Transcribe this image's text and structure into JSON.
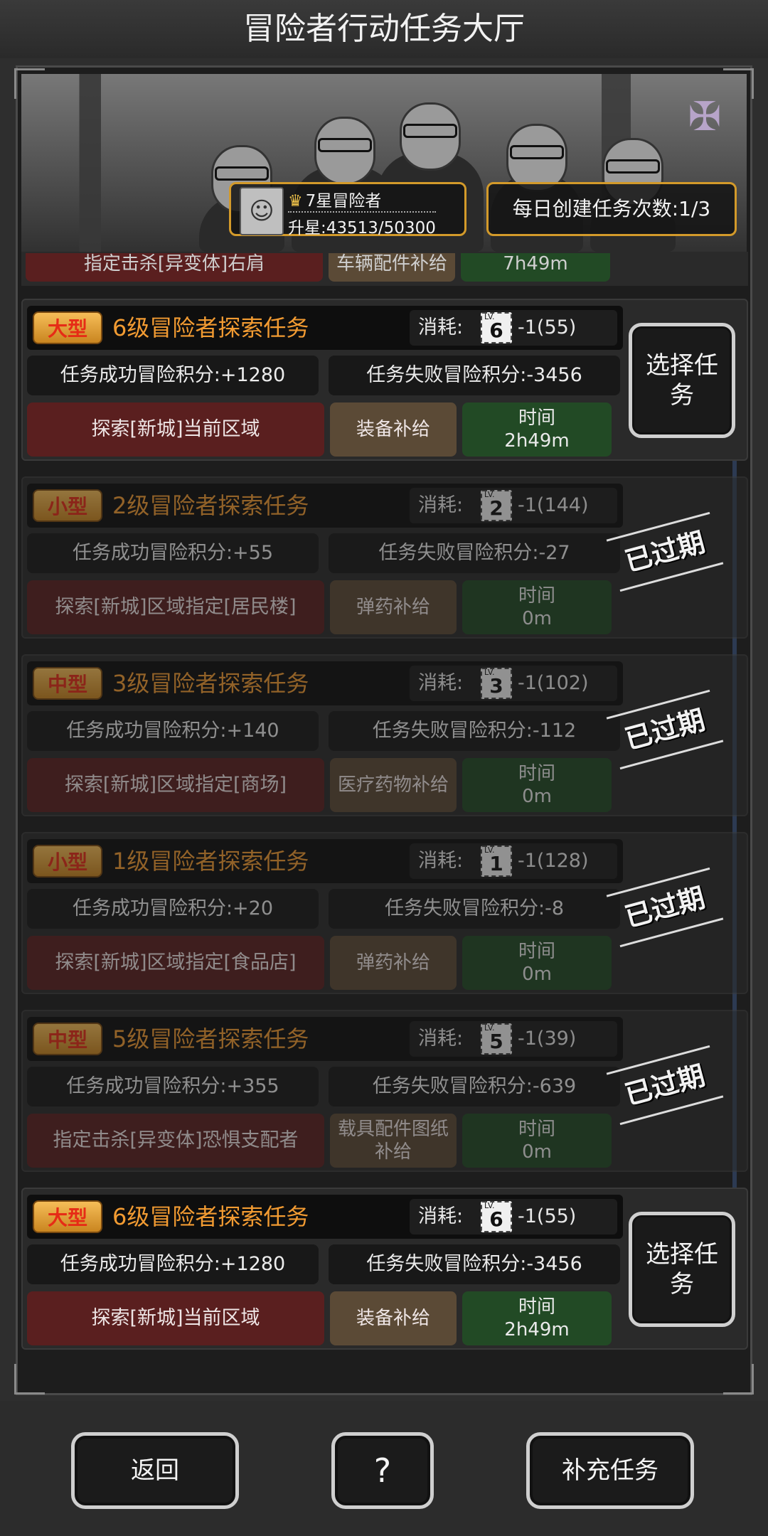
{
  "title": "冒险者行动任务大厅",
  "header": {
    "rank_name": "7星冒险者",
    "rank_progress": "升星:43513/50300",
    "daily_quota": "每日创建任务次数:1/3"
  },
  "partial_card": {
    "area": "指定击杀[异变体]右肩",
    "supply": "车辆配件补给",
    "time": "7h49m"
  },
  "missions": [
    {
      "tag": "大型",
      "title": "6级冒险者探索任务",
      "cost_label": "消耗:",
      "lv": "6",
      "cost": "-1(55)",
      "success": "任务成功冒险积分:+1280",
      "fail": "任务失败冒险积分:-3456",
      "area": "探索[新城]当前区域",
      "supply": "装备补给",
      "time_label": "时间",
      "time": "2h49m",
      "status": "选择任务",
      "expired": false
    },
    {
      "tag": "小型",
      "title": "2级冒险者探索任务",
      "cost_label": "消耗:",
      "lv": "2",
      "cost": "-1(144)",
      "success": "任务成功冒险积分:+55",
      "fail": "任务失败冒险积分:-27",
      "area": "探索[新城]区域指定[居民楼]",
      "supply": "弹药补给",
      "time_label": "时间",
      "time": "0m",
      "status": "已过期",
      "expired": true
    },
    {
      "tag": "中型",
      "title": "3级冒险者探索任务",
      "cost_label": "消耗:",
      "lv": "3",
      "cost": "-1(102)",
      "success": "任务成功冒险积分:+140",
      "fail": "任务失败冒险积分:-112",
      "area": "探索[新城]区域指定[商场]",
      "supply": "医疗药物补给",
      "time_label": "时间",
      "time": "0m",
      "status": "已过期",
      "expired": true
    },
    {
      "tag": "小型",
      "title": "1级冒险者探索任务",
      "cost_label": "消耗:",
      "lv": "1",
      "cost": "-1(128)",
      "success": "任务成功冒险积分:+20",
      "fail": "任务失败冒险积分:-8",
      "area": "探索[新城]区域指定[食品店]",
      "supply": "弹药补给",
      "time_label": "时间",
      "time": "0m",
      "status": "已过期",
      "expired": true
    },
    {
      "tag": "中型",
      "title": "5级冒险者探索任务",
      "cost_label": "消耗:",
      "lv": "5",
      "cost": "-1(39)",
      "success": "任务成功冒险积分:+355",
      "fail": "任务失败冒险积分:-639",
      "area": "指定击杀[异变体]恐惧支配者",
      "supply": "载具配件图纸补给",
      "time_label": "时间",
      "time": "0m",
      "status": "已过期",
      "expired": true
    },
    {
      "tag": "大型",
      "title": "6级冒险者探索任务",
      "cost_label": "消耗:",
      "lv": "6",
      "cost": "-1(55)",
      "success": "任务成功冒险积分:+1280",
      "fail": "任务失败冒险积分:-3456",
      "area": "探索[新城]当前区域",
      "supply": "装备补给",
      "time_label": "时间",
      "time": "2h49m",
      "status": "选择任务",
      "expired": false
    }
  ],
  "lv_prefix": "LV.",
  "bottom": {
    "back": "返回",
    "help_icon": "?",
    "replenish": "补充任务"
  }
}
